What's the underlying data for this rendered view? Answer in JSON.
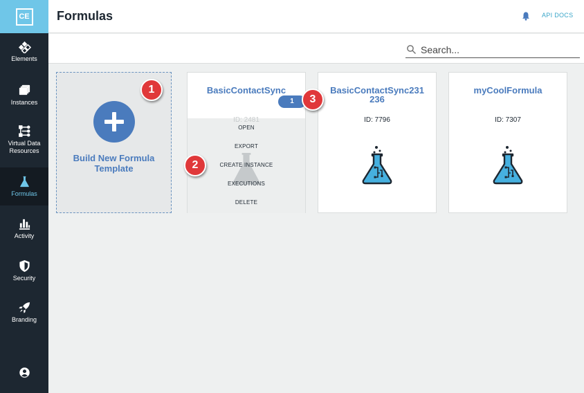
{
  "app": {
    "logo_text": "CE",
    "page_title": "Formulas",
    "api_docs_label": "API DOCS"
  },
  "sidebar": {
    "items": [
      {
        "label": "Elements",
        "icon": "elements-icon"
      },
      {
        "label": "Instances",
        "icon": "instances-icon"
      },
      {
        "label": "Virtual Data Resources",
        "icon": "vdr-icon"
      },
      {
        "label": "Formulas",
        "icon": "flask-icon",
        "active": true
      },
      {
        "label": "Activity",
        "icon": "bar-chart-icon"
      },
      {
        "label": "Security",
        "icon": "shield-icon"
      },
      {
        "label": "Branding",
        "icon": "rocket-icon"
      }
    ],
    "profile_icon": "user-icon"
  },
  "search": {
    "placeholder": "Search...",
    "value": ""
  },
  "build_card": {
    "label": "Build New Formula Template"
  },
  "formulas": [
    {
      "title": "BasicContactSync",
      "id_label": "ID: 2481",
      "menu": [
        "OPEN",
        "EXPORT",
        "CREATE INSTANCE",
        "EXECUTIONS",
        "DELETE"
      ],
      "instance_count": "1"
    },
    {
      "title": "BasicContactSync231 236",
      "id_label": "ID: 7796"
    },
    {
      "title": "myCoolFormula",
      "id_label": "ID: 7307"
    }
  ],
  "annotations": [
    "1",
    "2",
    "3"
  ],
  "colors": {
    "sidebar_bg": "#1d2731",
    "accent": "#6fc6e8",
    "brand_blue": "#4a7bbd",
    "marker_red": "#e0383a"
  }
}
